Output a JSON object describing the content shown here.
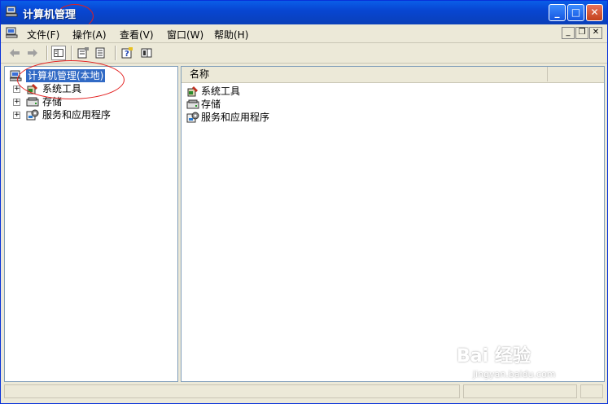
{
  "window": {
    "title": "计算机管理"
  },
  "menu": [
    {
      "label": "文件(F)"
    },
    {
      "label": "操作(A)"
    },
    {
      "label": "查看(V)"
    },
    {
      "label": "窗口(W)"
    },
    {
      "label": "帮助(H)"
    }
  ],
  "tree": {
    "root": "计算机管理(本地)",
    "children": [
      {
        "label": "系统工具",
        "icon": "tools-icon"
      },
      {
        "label": "存储",
        "icon": "storage-icon"
      },
      {
        "label": "服务和应用程序",
        "icon": "services-icon"
      }
    ]
  },
  "list": {
    "column": "名称",
    "items": [
      {
        "label": "系统工具"
      },
      {
        "label": "存储"
      },
      {
        "label": "服务和应用程序"
      }
    ]
  },
  "watermark": {
    "brand": "Bai 经验",
    "url": "jingyan.baidu.com"
  },
  "colors": {
    "titlebar": "#0a5ee8",
    "selection": "#316ac5",
    "annotation": "#e31e1e"
  }
}
